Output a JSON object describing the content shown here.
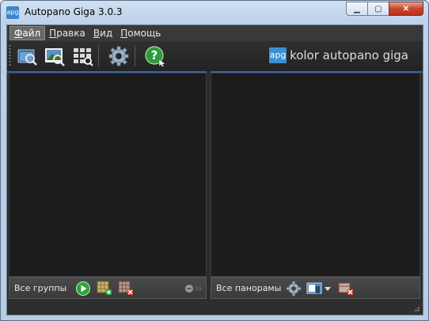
{
  "window": {
    "title": "Autopano Giga 3.0.3",
    "app_icon_text": "apg",
    "controls": {
      "minimize": "▁",
      "maximize": "▢",
      "close": "✕"
    }
  },
  "menubar": {
    "items": [
      {
        "label": "Файл",
        "underline": "Ф",
        "rest": "айл",
        "active": true
      },
      {
        "label": "Правка",
        "underline": "П",
        "rest": "равка"
      },
      {
        "label": "Вид",
        "underline": "В",
        "rest": "ид"
      },
      {
        "label": "Помощь",
        "underline": "П",
        "rest": "омощь"
      }
    ]
  },
  "toolbar": {
    "buttons": [
      {
        "name": "select-folder-button",
        "icon": "folder-search-icon"
      },
      {
        "name": "select-images-button",
        "icon": "image-search-icon"
      },
      {
        "name": "detect-button",
        "icon": "grid-detect-icon"
      },
      {
        "name": "settings-button",
        "icon": "gear-icon"
      },
      {
        "name": "help-button",
        "icon": "help-icon"
      }
    ]
  },
  "brand": {
    "logo_text": "apg",
    "text": "kolor autopano giga"
  },
  "left_panel": {
    "footer_label": "Все группы"
  },
  "right_panel": {
    "footer_label": "Все панорамы"
  },
  "colors": {
    "accent": "#2f6aa8",
    "panel_bg": "#1c1c1c",
    "toolbar_bg": "#2a2a2a"
  }
}
